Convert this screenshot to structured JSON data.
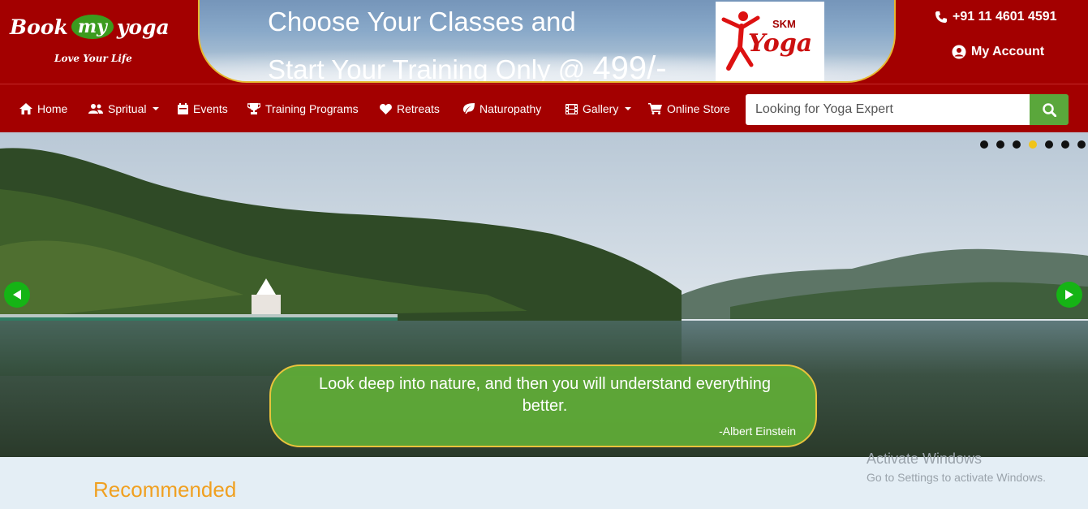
{
  "logo": {
    "book": "Book",
    "my": "my",
    "yoga": "yoga",
    "tagline": "Love Your Life"
  },
  "banner": {
    "line1": "Choose Your Classes and",
    "line2": "Start Your Training Only @",
    "price": "499/-",
    "card_brand": "SKM",
    "card_word": "Yoga"
  },
  "contact": {
    "phone": "+91 11 4601 4591",
    "account": "My Account"
  },
  "nav": {
    "items": [
      {
        "label": "Home",
        "icon": "home-icon",
        "dropdown": false
      },
      {
        "label": "Spritual",
        "icon": "users-icon",
        "dropdown": true
      },
      {
        "label": "Events",
        "icon": "calendar-icon",
        "dropdown": false
      },
      {
        "label": "Training Programs",
        "icon": "trophy-icon",
        "dropdown": false
      },
      {
        "label": "Retreats",
        "icon": "heart-icon",
        "dropdown": false
      },
      {
        "label": "Naturopathy",
        "icon": "leaf-icon",
        "dropdown": false
      },
      {
        "label": "Gallery",
        "icon": "film-icon",
        "dropdown": true
      },
      {
        "label": "Online Store",
        "icon": "cart-icon",
        "dropdown": false
      }
    ],
    "search_placeholder": "Looking for Yoga Expert"
  },
  "hero": {
    "slide_count": 7,
    "active_slide": 4,
    "quote": "Look deep into nature, and then you will understand everything better.",
    "author": "-Albert Einstein"
  },
  "section": {
    "title": "Recommended"
  },
  "windows_watermark": {
    "title": "Activate Windows",
    "subtitle": "Go to Settings to activate Windows."
  },
  "colors": {
    "header_red": "#a30000",
    "accent_green": "#5aa73b",
    "gold": "#e7b931",
    "heading_orange": "#f0a020"
  }
}
